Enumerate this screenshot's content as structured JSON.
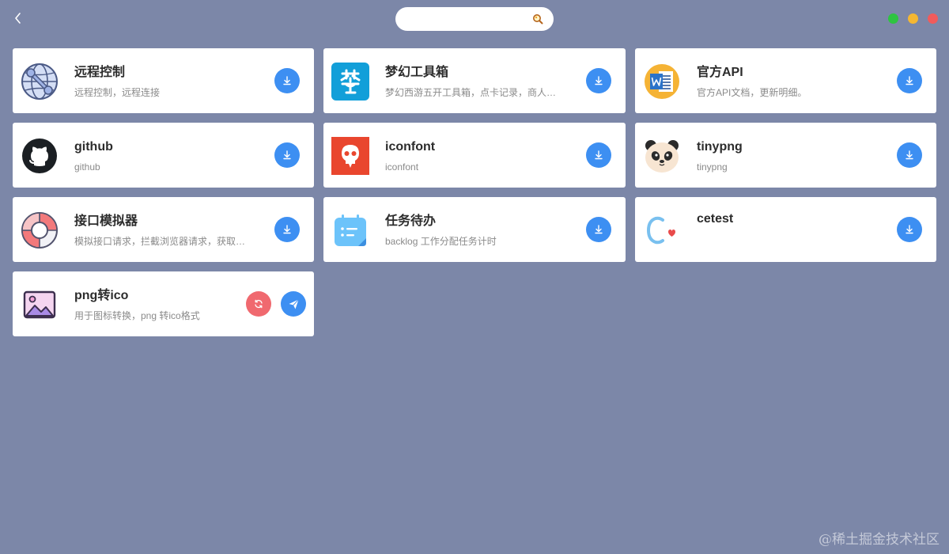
{
  "search": {
    "value": "",
    "placeholder": ""
  },
  "window_controls": [
    {
      "name": "maximize",
      "color": "#2ec441"
    },
    {
      "name": "minimize",
      "color": "#f5b732"
    },
    {
      "name": "close",
      "color": "#f15b5b"
    }
  ],
  "accent_color": "#3d8ff2",
  "apps": [
    {
      "title": "远程控制",
      "desc": "远程控制，远程连接",
      "icon": "globe-wrench-icon",
      "action": "download"
    },
    {
      "title": "梦幻工具箱",
      "desc": "梦幻西游五开工具箱，点卡记录，商人…",
      "icon": "meng-icon",
      "action": "download"
    },
    {
      "title": "官方API",
      "desc": "官方API文档，更新明细。",
      "icon": "word-doc-icon",
      "action": "download"
    },
    {
      "title": "github",
      "desc": "github",
      "icon": "github-icon",
      "action": "download"
    },
    {
      "title": "iconfont",
      "desc": "iconfont",
      "icon": "iconfont-icon",
      "action": "download"
    },
    {
      "title": "tinypng",
      "desc": "tinypng",
      "icon": "panda-icon",
      "action": "download"
    },
    {
      "title": "接口模拟器",
      "desc": "模拟接口请求，拦截浏览器请求，获取…",
      "icon": "lifebuoy-icon",
      "action": "download"
    },
    {
      "title": "任务待办",
      "desc": "backlog 工作分配任务计时",
      "icon": "calendar-icon",
      "action": "download"
    },
    {
      "title": "cetest",
      "desc": "",
      "icon": "c-heart-icon",
      "action": "download"
    },
    {
      "title": "png转ico",
      "desc": "用于图标转换，png 转ico格式",
      "icon": "image-icon",
      "action": "installed"
    }
  ],
  "watermark": "@稀土掘金技术社区"
}
